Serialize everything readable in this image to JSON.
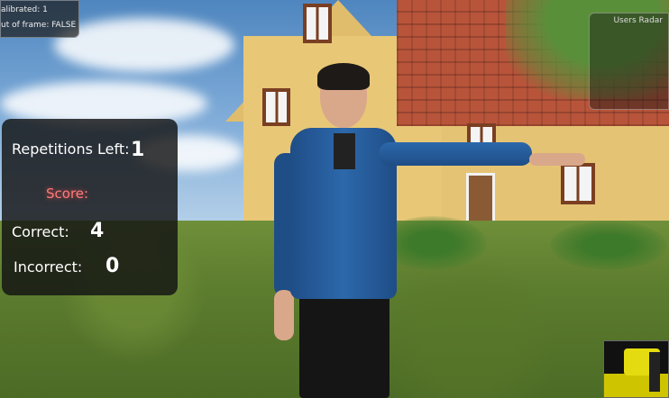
{
  "calibration": {
    "calibrated_text": "alibrated: 1",
    "out_of_frame_text": "ut of frame: FALSE"
  },
  "radar": {
    "title": "Users Radar"
  },
  "panel": {
    "repetitions_label": "Repetitions Left:",
    "repetitions_value": "1",
    "score_label": "Score:",
    "correct_label": "Correct:",
    "correct_value": "4",
    "incorrect_label": "Incorrect:",
    "incorrect_value": "0"
  },
  "colors": {
    "panel_bg": "#121212",
    "score_label": "#ff7a7a",
    "jacket": "#2c68ab",
    "house_wall": "#e8c777",
    "roof": "#b8543a"
  }
}
